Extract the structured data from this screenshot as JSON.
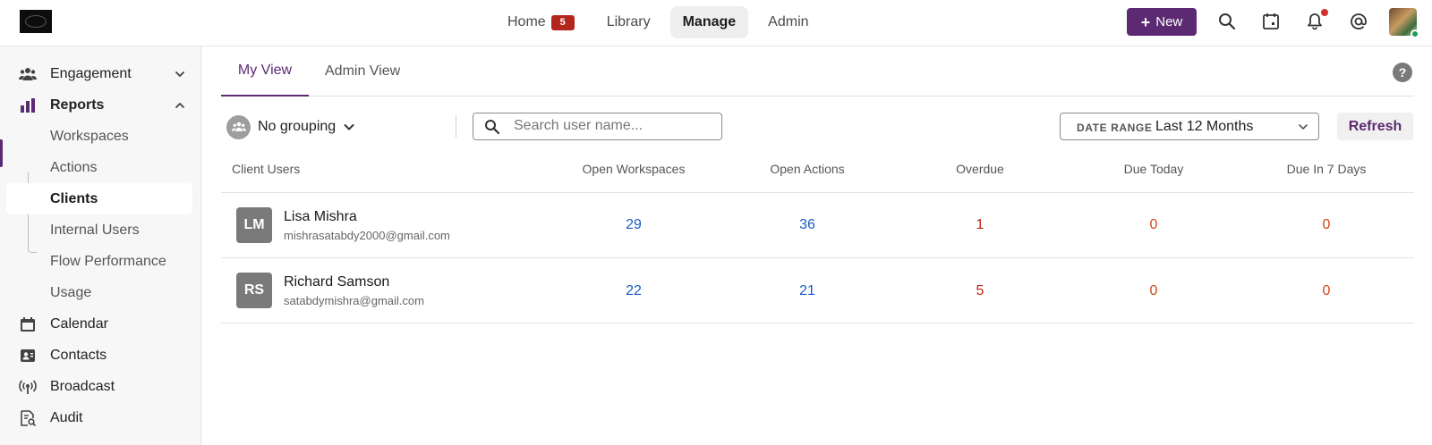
{
  "colors": {
    "brand": "#5c2a72",
    "link_blue": "#1a5bc4",
    "overdue_red": "#c0221b",
    "due_orange": "#d84315",
    "badge_red": "#b3261e"
  },
  "topnav": {
    "items": [
      {
        "label": "Home",
        "badge": "5"
      },
      {
        "label": "Library"
      },
      {
        "label": "Manage",
        "active": true
      },
      {
        "label": "Admin"
      }
    ],
    "new_button": "New",
    "icons": [
      "search-icon",
      "calendar-task-icon",
      "bell-icon",
      "at-mention-icon",
      "user-avatar"
    ]
  },
  "sidebar": {
    "items": [
      {
        "label": "Engagement",
        "icon": "people-icon",
        "expandable": "collapsed"
      },
      {
        "label": "Reports",
        "icon": "bar-chart-icon",
        "expandable": "expanded",
        "active": true
      },
      {
        "label": "Workspaces",
        "sub": true
      },
      {
        "label": "Actions",
        "sub": true
      },
      {
        "label": "Clients",
        "sub": true,
        "selected": true
      },
      {
        "label": "Internal Users",
        "sub": true
      },
      {
        "label": "Flow Performance",
        "sub": true
      },
      {
        "label": "Usage",
        "sub": true
      },
      {
        "label": "Calendar",
        "icon": "calendar-icon"
      },
      {
        "label": "Contacts",
        "icon": "contacts-icon"
      },
      {
        "label": "Broadcast",
        "icon": "broadcast-icon"
      },
      {
        "label": "Audit",
        "icon": "audit-icon"
      }
    ]
  },
  "tabs": [
    {
      "label": "My View",
      "active": true
    },
    {
      "label": "Admin View"
    }
  ],
  "toolbar": {
    "grouping": "No grouping",
    "search_placeholder": "Search user name...",
    "date_range_label": "DATE RANGE",
    "date_range_value": "Last 12 Months",
    "refresh": "Refresh"
  },
  "table": {
    "headers": [
      "Client Users",
      "Open Workspaces",
      "Open Actions",
      "Overdue",
      "Due Today",
      "Due In 7 Days"
    ],
    "rows": [
      {
        "initials": "LM",
        "name": "Lisa Mishra",
        "email": "mishrasatabdy2000@gmail.com",
        "open_workspaces": "29",
        "open_actions": "36",
        "overdue": "1",
        "due_today": "0",
        "due_7_days": "0"
      },
      {
        "initials": "RS",
        "name": "Richard Samson",
        "email": "satabdymishra@gmail.com",
        "open_workspaces": "22",
        "open_actions": "21",
        "overdue": "5",
        "due_today": "0",
        "due_7_days": "0"
      }
    ]
  }
}
